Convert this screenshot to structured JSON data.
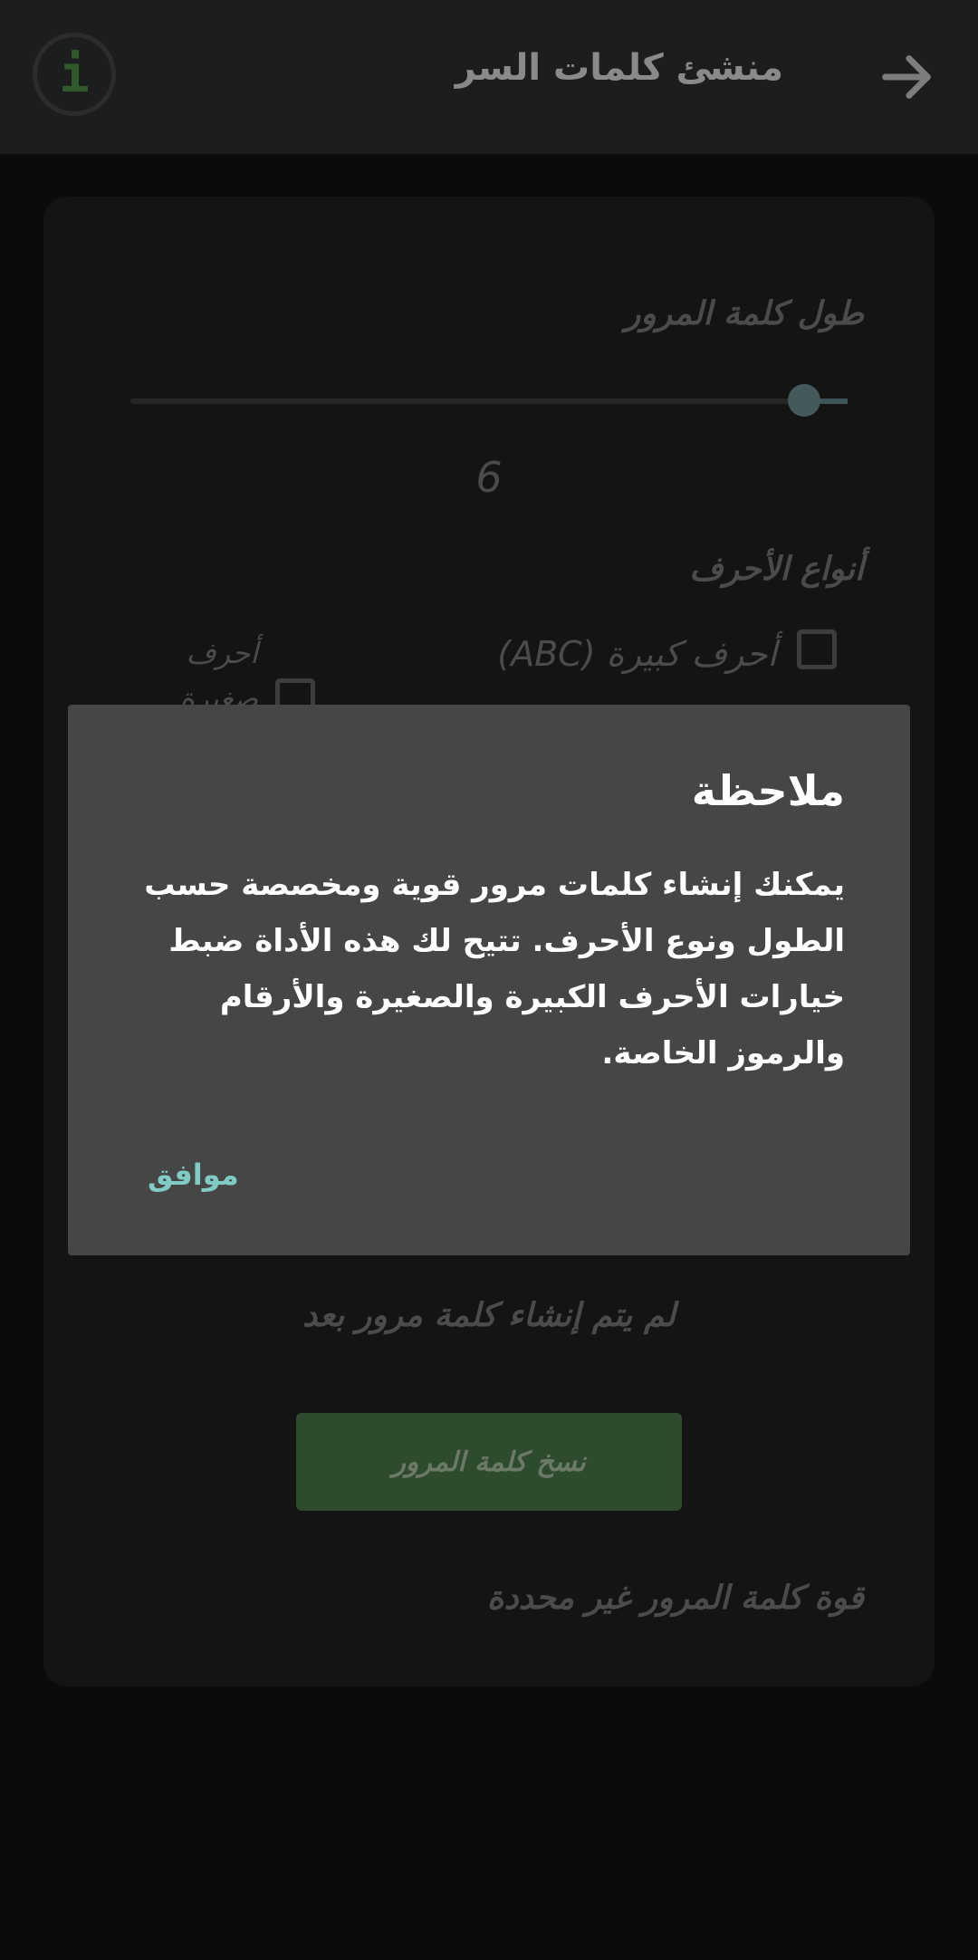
{
  "appbar": {
    "title": "منشئ كلمات السر",
    "back_icon": "arrow-forward-icon",
    "info_icon": "info-icon",
    "info_letter": "i"
  },
  "generator": {
    "length_label": "طول كلمة المرور",
    "length_value": "6",
    "slider_fraction": 0.94,
    "char_types_label": "أنواع الأحرف",
    "uppercase_label": "أحرف كبيرة (ABC)",
    "uppercase_checked": false,
    "lowercase_label_line1": "أحرف",
    "lowercase_label_line2": "صغيرة",
    "lowercase_checked": false,
    "status_text": "لم يتم إنشاء كلمة مرور بعد",
    "copy_button": "نسخ كلمة المرور",
    "strength_text": "قوة كلمة المرور غير محددة"
  },
  "dialog": {
    "title": "ملاحظة",
    "body": "يمكنك إنشاء كلمات مرور قوية ومخصصة حسب الطول ونوع الأحرف. تتيح لك هذه الأداة ضبط خيارات الأحرف الكبيرة والصغيرة والأرقام والرموز الخاصة.",
    "ok_button": "موافق"
  },
  "colors": {
    "accent": "#80cbc4",
    "dialog_bg": "#464646",
    "copy_button_bg": "#2f4b2e",
    "info_icon_color": "#2f5a2a"
  }
}
